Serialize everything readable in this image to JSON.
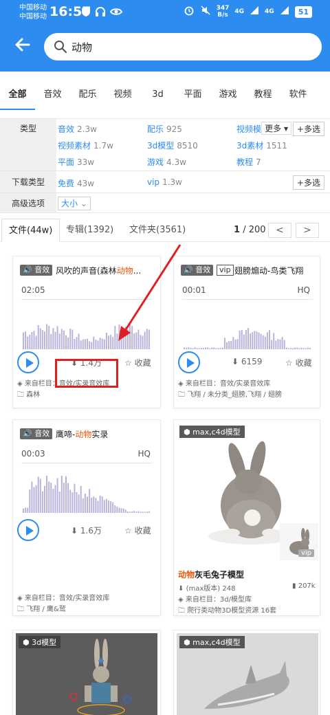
{
  "status": {
    "carrier1": "中国移动",
    "carrier2": "中国移动",
    "time": "16:57",
    "speed_value": "347",
    "speed_unit": "B/s",
    "net1": "4G",
    "net2": "4G",
    "battery": "51"
  },
  "search": {
    "value": "动物"
  },
  "category_tabs": [
    "全部",
    "音效",
    "配乐",
    "视频",
    "3d",
    "平面",
    "游戏",
    "教程",
    "软件"
  ],
  "filters": {
    "type_label": "类型",
    "more_label": "更多",
    "multi_label": "多选",
    "items": [
      {
        "name": "音效",
        "count": "2.3w"
      },
      {
        "name": "配乐",
        "count": "925"
      },
      {
        "name": "视频模板",
        "count": ""
      },
      {
        "name": "视频素材",
        "count": "1.7w"
      },
      {
        "name": "3d模型",
        "count": "8510"
      },
      {
        "name": "3d素材",
        "count": "1511"
      },
      {
        "name": "平面",
        "count": "33w"
      },
      {
        "name": "游戏",
        "count": "4.3w"
      },
      {
        "name": "教程",
        "count": "7"
      }
    ],
    "download_label": "下载类型",
    "download_items": [
      {
        "name": "免费",
        "count": "43w"
      },
      {
        "name": "vip",
        "count": "1.3w"
      }
    ],
    "download_multi": "多选",
    "advanced_label": "高级选项",
    "size_select": "大小"
  },
  "result_tabs": {
    "files": "文件(44w)",
    "albums": "专辑(1392)",
    "folders": "文件夹(3561)",
    "page_current": "1",
    "page_total": "/ 200",
    "prev": "<",
    "next": ">"
  },
  "cards": {
    "c1": {
      "badge": "音效",
      "title_pre": "风吹的声音(森林",
      "title_hl": "动物",
      "title_post": "...",
      "duration": "02:05",
      "downloads": "1.4万",
      "fav": "收藏",
      "source": "来自栏目：音效/实录音效库",
      "folder": "森林"
    },
    "c2": {
      "badge": "音效",
      "vip": "vip",
      "title": "翅膀煽动-鸟类飞翔",
      "duration": "00:01",
      "hq": "HQ",
      "downloads": "6159",
      "fav": "收藏",
      "source": "来自栏目：音效/实录音效库",
      "folder": "飞翔 / 未分类_翅膀,飞翔 / 翅膀"
    },
    "c3": {
      "badge": "音效",
      "title_pre": "鹰啼-",
      "title_hl": "动物",
      "title_post": "实录",
      "duration": "00:03",
      "hq": "HQ",
      "downloads": "1.6万",
      "fav": "收藏",
      "source": "来自栏目：音效/实录音效库",
      "folder": "飞翔 / 鹰&鹫"
    },
    "c4": {
      "tag": "max,c4d模型",
      "vip": "vip",
      "title_hl": "动物",
      "title_post": "灰毛兔子模型",
      "version": "(max版本) 248",
      "size": "207k",
      "source": "来自栏目：3d/模型库",
      "folder": "爬行类动物3D模型资源 16套"
    },
    "c5": {
      "tag": "3d模型"
    },
    "c6": {
      "tag": "max,c4d模型"
    }
  },
  "colors": {
    "accent": "#2d8cf0",
    "highlight": "#e8590c",
    "annotation": "#e02020"
  }
}
